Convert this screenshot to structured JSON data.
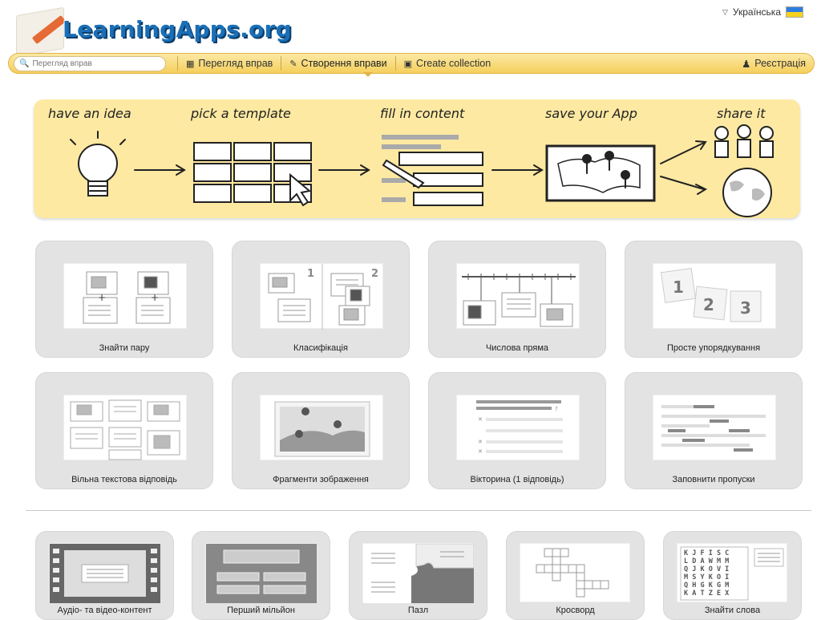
{
  "brand": {
    "logo_text": "LearningApps.org"
  },
  "language": {
    "label": "Українська"
  },
  "navbar": {
    "search_placeholder": "Перегляд вправ",
    "items": [
      {
        "label": "Перегляд вправ",
        "icon": "grid-icon"
      },
      {
        "label": "Створення вправи",
        "icon": "pencil-icon"
      },
      {
        "label": "Create collection",
        "icon": "collection-icon"
      }
    ],
    "register_label": "Реєстрація"
  },
  "banner": {
    "steps": [
      "have an idea",
      "pick a template",
      "fill in content",
      "save your App",
      "share it"
    ]
  },
  "templates_row1": [
    {
      "label": "Знайти пару"
    },
    {
      "label": "Класифікація"
    },
    {
      "label": "Числова пряма"
    },
    {
      "label": "Просте упорядкування"
    }
  ],
  "templates_row2": [
    {
      "label": "Вільна текстова відповідь"
    },
    {
      "label": "Фрагменти зображення"
    },
    {
      "label": "Вікторина (1 відповідь)"
    },
    {
      "label": "Заповнити пропуски"
    }
  ],
  "templates_row3": [
    {
      "label": "Аудіо- та відео-контент"
    },
    {
      "label": "Перший мільйон"
    },
    {
      "label": "Пазл"
    },
    {
      "label": "Кросворд"
    },
    {
      "label": "Знайти слова"
    }
  ],
  "thumbs": {
    "classify_numbers": [
      "1",
      "2"
    ],
    "ordering_numbers": [
      "1",
      "2",
      "3"
    ],
    "wordsearch_rows": [
      "K J F I S C",
      "L D A W M M",
      "Q J K O V I",
      "M S Y K O I",
      "Q H G K G M",
      "K A T Z E X"
    ]
  },
  "colors": {
    "nav_bg": "#f5cf5b",
    "banner_bg": "#fde9a2",
    "card_bg": "#e3e3e3",
    "logo_blue": "#1a6fb7"
  }
}
